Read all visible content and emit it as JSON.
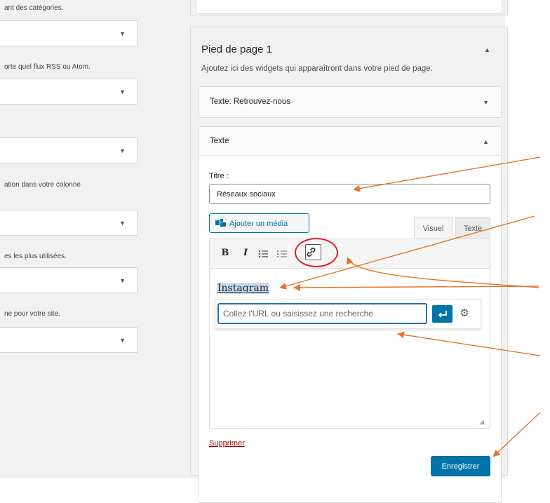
{
  "left_column": {
    "top_desc": "ant des catégories.",
    "descriptions": [
      "orte quel flux RSS ou Atom.",
      "ation dans votre colonne",
      "es les plus utilisées.",
      "ne pour votre site."
    ]
  },
  "panel": {
    "title": "Pied de page 1",
    "description": "Ajoutez ici des widgets qui apparaîtront dans votre pied de page."
  },
  "widgets": {
    "retrouvez_title": "Texte: Retrouvez-nous",
    "texte_title": "Texte"
  },
  "form": {
    "titre_label": "Titre :",
    "titre_value": "Réseaux sociaux",
    "add_media_label": "Ajouter un média",
    "tab_visuel": "Visuel",
    "tab_texte": "Texte"
  },
  "toolbar": {
    "bold": "B",
    "italic": "I",
    "link_icon": "link-icon"
  },
  "editor": {
    "content": "Instagram",
    "url_placeholder": "Collez l'URL ou saisissez une recherche"
  },
  "actions": {
    "delete_label": "Supprimer",
    "save_label": "Enregistrer"
  },
  "colors": {
    "accent": "#0073aa",
    "delete": "#a00000",
    "annotation_arrow": "#e8742a",
    "highlight_circle": "#e0202a"
  }
}
